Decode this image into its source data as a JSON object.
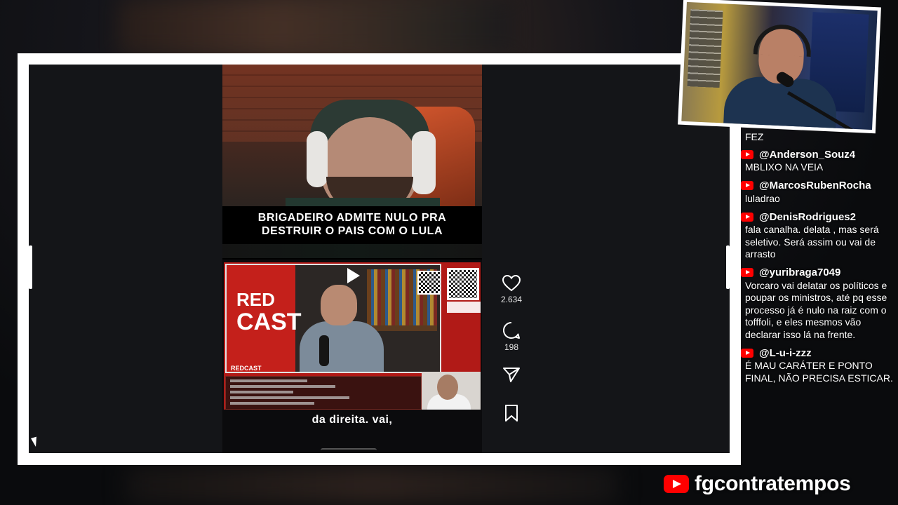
{
  "reel": {
    "caption": "BRIGADEIRO ADMITE NULO PRA DESTRUIR O PAIS COM O LULA",
    "embed_logo_line1": "RED",
    "embed_logo_line2": "CAST",
    "embed_logo_small": "REDCAST",
    "subtitle": "da direita. vai,"
  },
  "actions": {
    "like_count": "2.634",
    "comment_count": "198",
    "icons": [
      "heart-icon",
      "comment-icon",
      "share-icon",
      "bookmark-icon",
      "more-icon"
    ]
  },
  "chat": {
    "cut_text": "FEZ",
    "messages": [
      {
        "user": "@Anderson_Souz4",
        "text": "MBLIXO NA VEIA"
      },
      {
        "user": "@MarcosRubenRocha",
        "text": "luladrao"
      },
      {
        "user": "@DenisRodrigues2",
        "text": "fala canalha. delata , mas será seletivo. Será assim ou vai de arrasto"
      },
      {
        "user": "@yuribraga7049",
        "text": "Vorcaro vai delatar os políticos e poupar os ministros, até pq esse processo já é nulo na raiz com o tofffoli, e eles mesmos vão declarar isso lá na frente."
      },
      {
        "user": "@L-u-i-zzz",
        "text": "É MAU CARÁTER E PONTO FINAL, NÃO PRECISA ESTICAR."
      }
    ]
  },
  "brand": {
    "name": "fgcontratempos",
    "accent": "#ff0000"
  }
}
